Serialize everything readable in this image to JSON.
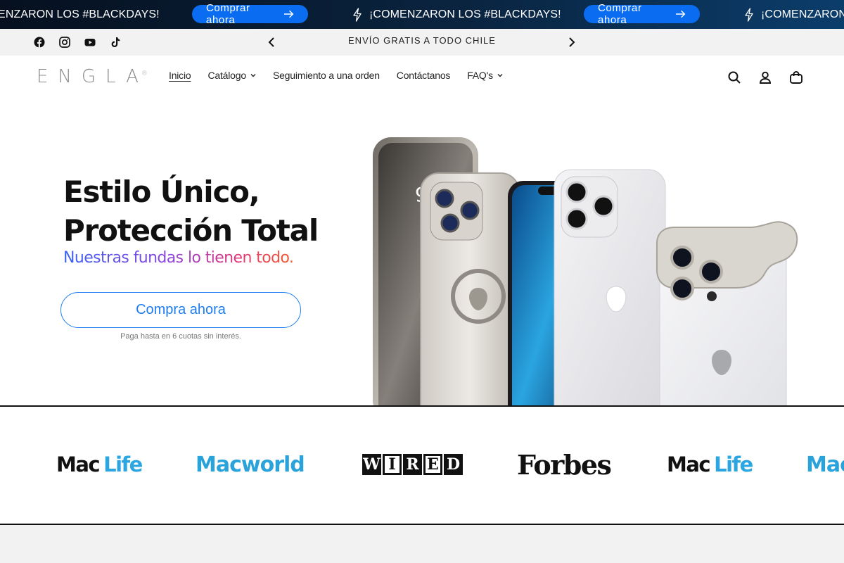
{
  "announcement_bar": {
    "message": "¡COMENZARON LOS #BLACKDAYS!",
    "cta_label": "Comprar ahora",
    "icons": [
      "bolt-icon",
      "arrow-right-icon"
    ],
    "background": "#0a2440",
    "button_color": "#0a6cf0"
  },
  "utility_bar": {
    "socials": [
      "facebook-icon",
      "instagram-icon",
      "youtube-icon",
      "tiktok-icon"
    ],
    "announcement": "ENVÍO GRATIS A TODO CHILE",
    "prev_icon": "chevron-left-icon",
    "next_icon": "chevron-right-icon"
  },
  "header": {
    "logo": "ENGLA",
    "logo_mark": "®",
    "nav": [
      {
        "label": "Inicio",
        "active": true
      },
      {
        "label": "Catálogo",
        "dropdown": true
      },
      {
        "label": "Seguimiento a una orden"
      },
      {
        "label": "Contáctanos"
      },
      {
        "label": "FAQ's",
        "dropdown": true
      }
    ],
    "icons": [
      "search-icon",
      "account-icon",
      "cart-icon"
    ]
  },
  "hero": {
    "title_line1": "Estilo Único,",
    "title_line2": "Protección Total",
    "subtitle": "Nuestras fundas lo tienen todo.",
    "cta_label": "Compra ahora",
    "note": "Paga hasta en 6 cuotas sin interés.",
    "accent": "#1e7df0",
    "phone_time": "9:"
  },
  "press": {
    "mac_life_left": "Mac",
    "mac_life_right": "Life",
    "macworld": "Macworld",
    "wired": [
      "W",
      "I",
      "R",
      "E",
      "D"
    ],
    "forbes": "Forbes",
    "macworld_partial": "Mac"
  }
}
